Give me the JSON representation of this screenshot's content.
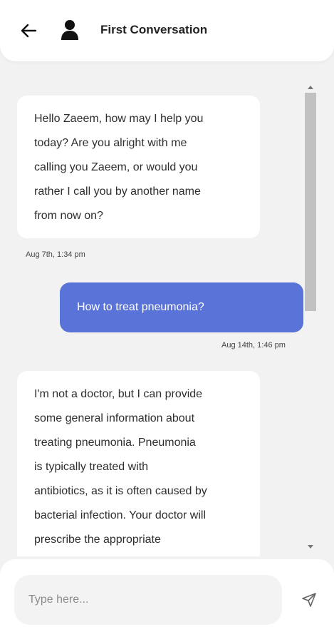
{
  "header": {
    "title": "First Conversation",
    "back_icon": "arrow-left-icon",
    "avatar_icon": "user-icon"
  },
  "messages": [
    {
      "sender": "bot",
      "lines": [
        "Hello Zaeem, how may I help you",
        "today? Are you alright with me",
        "calling you Zaeem, or would you",
        "rather I call you by another name",
        "from now on?"
      ],
      "timestamp": "Aug 7th, 1:34 pm"
    },
    {
      "sender": "user",
      "text": "How to treat pneumonia?",
      "timestamp": "Aug 14th, 1:46 pm"
    },
    {
      "sender": "bot",
      "lines": [
        "I'm not a doctor, but I can provide",
        "some general information about",
        "treating pneumonia. Pneumonia",
        "is typically treated with",
        "antibiotics, as it is often caused by",
        "bacterial infection. Your doctor will",
        "prescribe the appropriate"
      ]
    }
  ],
  "composer": {
    "placeholder": "Type here...",
    "value": "",
    "send_icon": "send-icon"
  },
  "colors": {
    "user_bubble": "#5a73d8",
    "bot_bubble": "#ffffff",
    "background": "#f2f2f2"
  }
}
